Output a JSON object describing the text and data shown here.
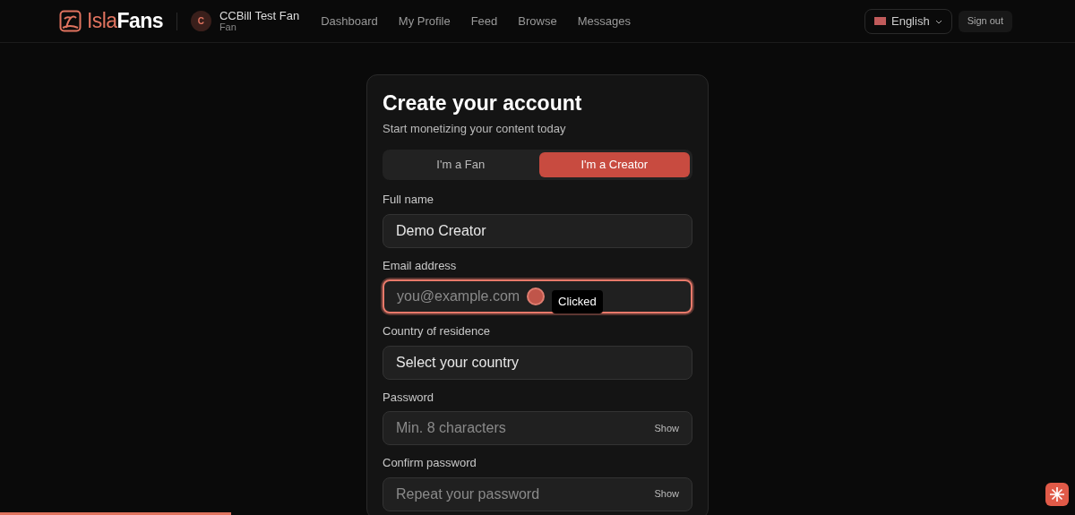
{
  "header": {
    "brand": {
      "part1": "Isla",
      "part2": "Fans"
    },
    "user": {
      "initial": "C",
      "name": "CCBill Test Fan",
      "role": "Fan"
    },
    "nav": [
      {
        "label": "Dashboard"
      },
      {
        "label": "My Profile"
      },
      {
        "label": "Feed"
      },
      {
        "label": "Browse"
      },
      {
        "label": "Messages"
      }
    ],
    "language": "English",
    "sign_out": "Sign out"
  },
  "card": {
    "title": "Create your account",
    "subtitle": "Start monetizing your content today",
    "roles": [
      {
        "label": "I'm a Fan",
        "selected": false
      },
      {
        "label": "I'm a Creator",
        "selected": true
      }
    ],
    "fields": [
      {
        "kind": "text",
        "label": "Full name",
        "value": "Demo Creator",
        "focused": false
      },
      {
        "kind": "text",
        "label": "Email address",
        "placeholder": "you@example.com",
        "focused": true,
        "tooltip": "Clicked"
      },
      {
        "kind": "select",
        "label": "Country of residence",
        "value": "Select your country",
        "focused": false
      },
      {
        "kind": "password",
        "label": "Password",
        "placeholder": "Min. 8 characters",
        "toggle": "Show",
        "focused": false
      },
      {
        "kind": "password",
        "label": "Confirm password",
        "placeholder": "Repeat your password",
        "toggle": "Show",
        "focused": false
      }
    ]
  },
  "progress": {
    "level": 0.215
  }
}
